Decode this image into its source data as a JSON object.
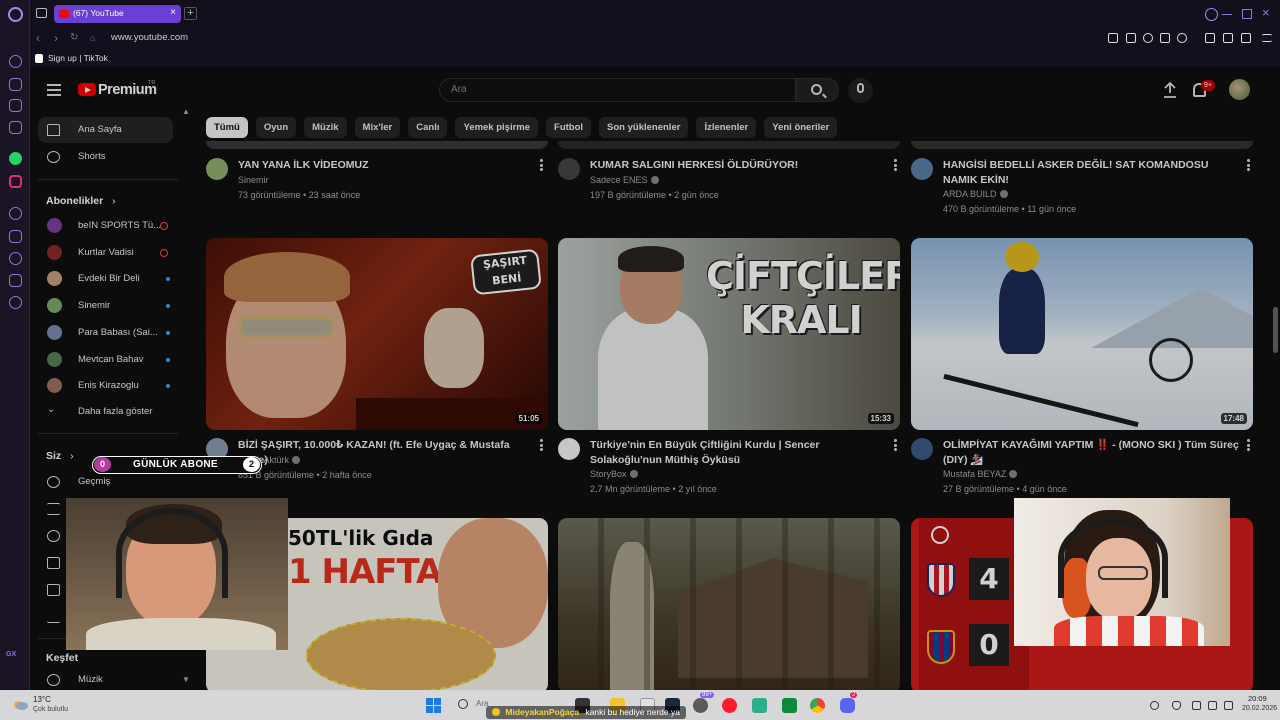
{
  "browser": {
    "tab_title": "(67) YouTube",
    "url": "www.youtube.com",
    "bookmark": "Sign up | TikTok"
  },
  "youtube": {
    "logo": "Premium",
    "logo_tr": "TR",
    "search_placeholder": "Ara",
    "notification_count": "9+",
    "chips": [
      "Tümü",
      "Oyun",
      "Müzik",
      "Mix'ler",
      "Canlı",
      "Yemek pişirme",
      "Futbol",
      "Son yüklenenler",
      "İzlenenler",
      "Yeni öneriler"
    ],
    "sidebar": {
      "home": "Ana Sayfa",
      "shorts": "Shorts",
      "subscriptions_header": "Abonelikler",
      "subscriptions": [
        {
          "name": "beIN SPORTS Tü...",
          "status": "live",
          "color": "#7b3fa0"
        },
        {
          "name": "Kurtlar Vadisi",
          "status": "live",
          "color": "#8a2a2a"
        },
        {
          "name": "Evdeki Bir Deli",
          "status": "new",
          "color": "#c8a07a"
        },
        {
          "name": "Sinemir",
          "status": "new",
          "color": "#7aa86b"
        },
        {
          "name": "Para Babası (Sai...",
          "status": "new",
          "color": "#7a8cb0"
        },
        {
          "name": "Mevtcan Bahav",
          "status": "new",
          "color": "#5a7d5a"
        },
        {
          "name": "Enis Kirazoglu",
          "status": "new",
          "color": "#a07060"
        }
      ],
      "show_more": "Daha fazla göster",
      "you_header": "Siz",
      "history": "Geçmiş",
      "explore_header": "Keşfet",
      "music": "Müzik"
    },
    "videos_row1": [
      {
        "title": "YAN YANA İLK VİDEOMUZ",
        "channel": "Sinemir",
        "stats": "73 görüntüleme • 23 saat önce",
        "verified": false
      },
      {
        "title": "KUMAR SALGINI HERKESİ ÖLDÜRÜYOR!",
        "channel": "Sadece ENES",
        "stats": "197 B görüntüleme • 2 gün önce",
        "verified": true
      },
      {
        "title": "HANGİSİ BEDELLİ ASKER DEĞİL! SAT KOMANDOSU NAMIK EKİN!",
        "channel": "ARDA BUILD",
        "stats": "470 B görüntüleme • 11 gün önce",
        "verified": true
      }
    ],
    "videos_row2": [
      {
        "title": "BİZİ ŞAŞIRT, 10.000₺ KAZAN! (ft. Efe Uygaç & Mustafa Emre)",
        "channel": "Burak Aktürk",
        "stats": "851 B görüntüleme • 2 hafta önce",
        "duration": "51:05",
        "verified": true,
        "thumb_text": "ŞAŞIRT BENİ"
      },
      {
        "title": "Türkiye'nin En Büyük Çiftliğini Kurdu | Sencer Solakoğlu'nun Müthiş Öyküsü",
        "channel": "StoryBox",
        "stats": "2,7 Mn görüntüleme • 2 yıl önce",
        "duration": "15:33",
        "verified": true,
        "thumb_text": "ÇİFTÇİLER KRALI"
      },
      {
        "title": "OLİMPİYAT KAYAĞIMI YAPTIM ‼️ - (MONO SKI ) Tüm Süreç (DIY) 🏂",
        "channel": "Mustafa BEYAZ",
        "stats": "27 B görüntüleme • 4 gün önce",
        "duration": "17:48",
        "verified": true
      }
    ],
    "row3_thumb_text_a": "50TL'lik Gıda",
    "row3_thumb_text_b": "1 HAFTA",
    "row3_score_top": "4",
    "row3_score_bottom": "0"
  },
  "overlay": {
    "counter_left": "0",
    "counter_label": "GÜNLÜK ABONE",
    "counter_right": "2",
    "chat_user": "MideyakanPoğaça",
    "chat_message": "kanki bu hediye nerde ya"
  },
  "taskbar": {
    "weather_temp": "13°C",
    "weather_desc": "Çok bulutlu",
    "search_text": "Ara",
    "time": "20:09",
    "date": "20.02.2026",
    "badge_a": "99+",
    "badge_b": "2"
  }
}
